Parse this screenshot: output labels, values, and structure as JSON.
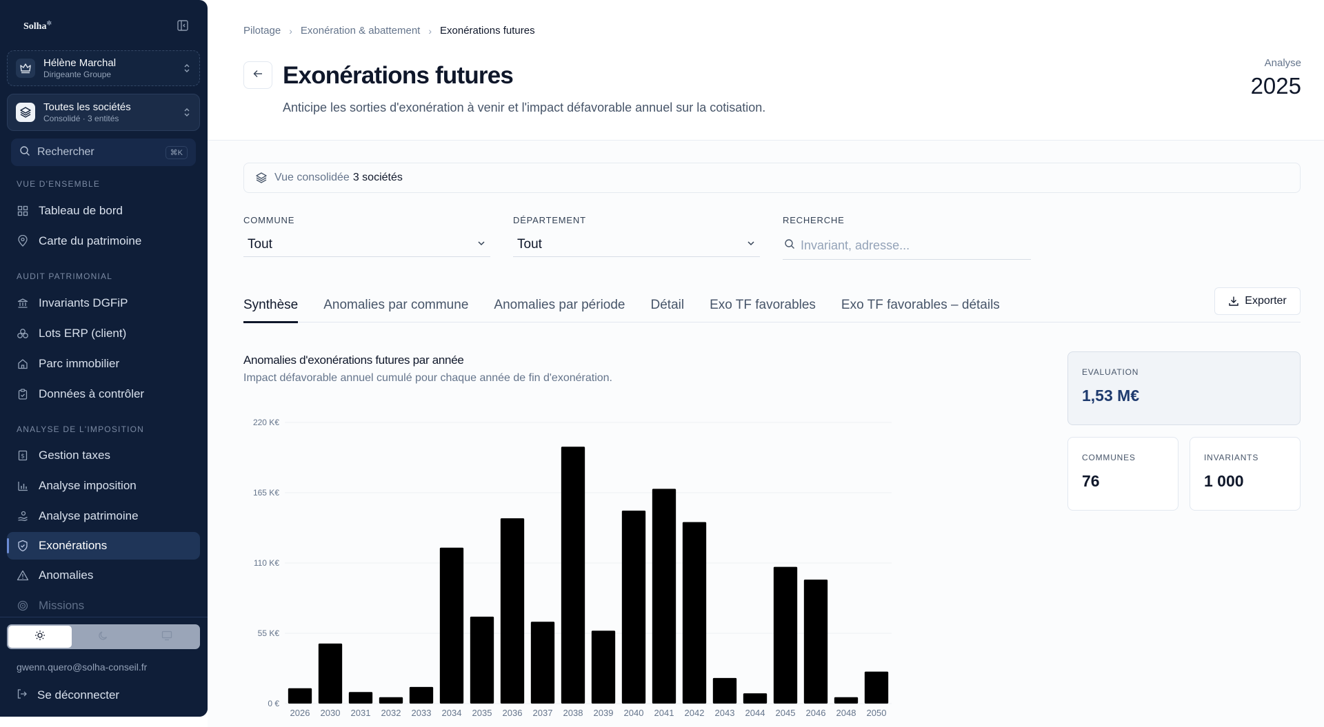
{
  "sidebar": {
    "logo": "Solha",
    "user": {
      "name": "Hélène Marchal",
      "role": "Dirigeante Groupe"
    },
    "company": {
      "name": "Toutes les sociétés",
      "detail": "Consolidé · 3 entités"
    },
    "search": {
      "label": "Rechercher",
      "shortcut": "⌘K"
    },
    "sections": [
      {
        "title": "VUE D'ENSEMBLE",
        "items": [
          {
            "label": "Tableau de bord",
            "icon": "grid-icon"
          },
          {
            "label": "Carte du patrimoine",
            "icon": "map-pin-icon"
          }
        ]
      },
      {
        "title": "AUDIT PATRIMONIAL",
        "items": [
          {
            "label": "Invariants DGFiP",
            "icon": "bank-icon"
          },
          {
            "label": "Lots ERP (client)",
            "icon": "boxes-icon"
          },
          {
            "label": "Parc immobilier",
            "icon": "home-icon"
          },
          {
            "label": "Données à contrôler",
            "icon": "clipboard-check-icon"
          }
        ]
      },
      {
        "title": "ANALYSE DE L'IMPOSITION",
        "items": [
          {
            "label": "Gestion taxes",
            "icon": "receipt-icon"
          },
          {
            "label": "Analyse imposition",
            "icon": "bar-chart-icon"
          },
          {
            "label": "Analyse patrimoine",
            "icon": "hand-coins-icon"
          },
          {
            "label": "Exonérations",
            "icon": "shield-check-icon"
          },
          {
            "label": "Anomalies",
            "icon": "warning-icon"
          },
          {
            "label": "Missions",
            "icon": "target-icon"
          }
        ]
      }
    ],
    "active_item": "Exonérations",
    "theme_options": [
      "sun-icon",
      "moon-icon",
      "monitor-icon"
    ],
    "email": "gwenn.quero@solha-conseil.fr",
    "logout": "Se déconnecter"
  },
  "header": {
    "breadcrumb": [
      "Pilotage",
      "Exonération & abattement",
      "Exonérations futures"
    ],
    "title": "Exonérations futures",
    "subtitle": "Anticipe les sorties d'exonération à venir et l'impact défavorable annuel sur la cotisation.",
    "analyse_label": "Analyse",
    "analyse_year": "2025"
  },
  "consolidated": {
    "prefix": "Vue consolidée",
    "value": "3 sociétés"
  },
  "filters": {
    "commune": {
      "label": "COMMUNE",
      "value": "Tout"
    },
    "departement": {
      "label": "DÉPARTEMENT",
      "value": "Tout"
    },
    "recherche": {
      "label": "RECHERCHE",
      "placeholder": "Invariant, adresse..."
    }
  },
  "tabs": [
    "Synthèse",
    "Anomalies par commune",
    "Anomalies par période",
    "Détail",
    "Exo TF favorables",
    "Exo TF favorables – détails"
  ],
  "active_tab": "Synthèse",
  "export_label": "Exporter",
  "chart_title": "Anomalies d'exonérations futures par année",
  "chart_subtitle": "Impact défavorable annuel cumulé pour chaque année de fin d'exonération.",
  "chart_data": {
    "type": "bar",
    "categories": [
      "2026",
      "2030",
      "2031",
      "2032",
      "2033",
      "2034",
      "2035",
      "2036",
      "2037",
      "2038",
      "2039",
      "2040",
      "2041",
      "2042",
      "2043",
      "2044",
      "2045",
      "2046",
      "2048",
      "2050"
    ],
    "values": [
      12,
      47,
      9,
      5,
      13,
      122,
      68,
      145,
      64,
      201,
      57,
      151,
      168,
      142,
      20,
      8,
      107,
      97,
      5,
      25
    ],
    "ylim": [
      0,
      220
    ],
    "yticks": [
      0,
      55,
      110,
      165,
      220
    ],
    "ytick_labels": [
      "0 €",
      "55 K€",
      "110 K€",
      "165 K€",
      "220 K€"
    ],
    "grid": true,
    "bar_color": "#000000"
  },
  "kpis": {
    "evaluation": {
      "label": "EVALUATION",
      "value": "1,53 M€"
    },
    "communes": {
      "label": "COMMUNES",
      "value": "76"
    },
    "invariants": {
      "label": "INVARIANTS",
      "value": "1 000"
    }
  }
}
